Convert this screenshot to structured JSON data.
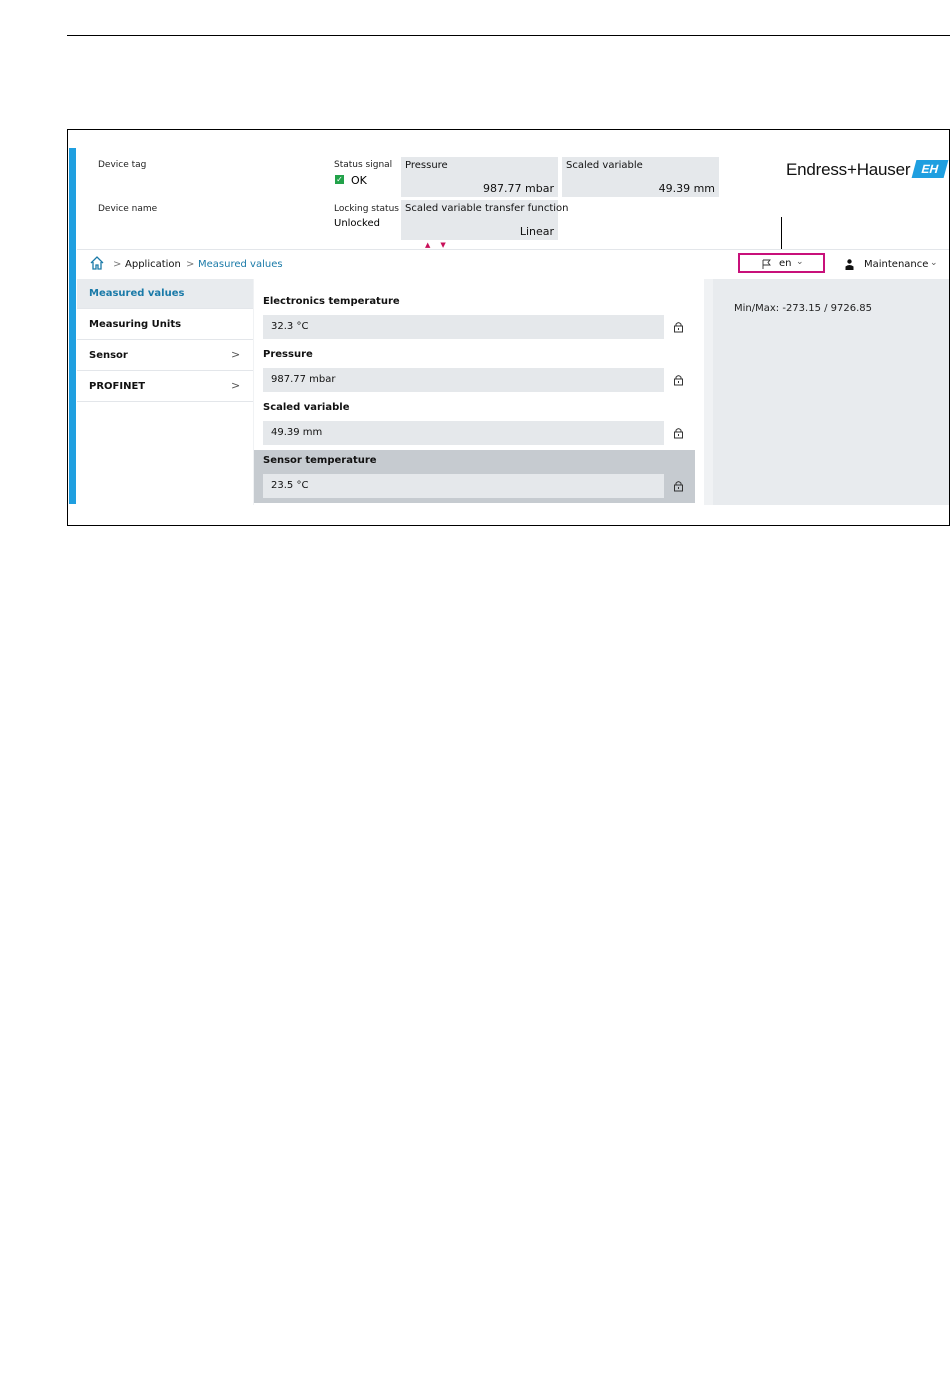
{
  "header": {
    "device_tag_label": "Device tag",
    "device_name_label": "Device name",
    "status_signal_label": "Status signal",
    "status_signal_value": "OK",
    "locking_status_label": "Locking status",
    "locking_status_value": "Unlocked",
    "tiles": [
      {
        "label": "Pressure",
        "value": "987.77 mbar"
      },
      {
        "label": "Scaled variable",
        "value": "49.39 mm"
      },
      {
        "label": "Scaled variable transfer function",
        "value": "Linear"
      }
    ],
    "logo_text": "Endress+Hauser",
    "logo_badge": "EH"
  },
  "nav": {
    "breadcrumb": [
      "Application",
      "Measured values"
    ],
    "language": "en",
    "user_role": "Maintenance"
  },
  "sidebar": {
    "items": [
      {
        "label": "Measured values",
        "active": true,
        "has_children": false
      },
      {
        "label": "Measuring Units",
        "active": false,
        "has_children": false
      },
      {
        "label": "Sensor",
        "active": false,
        "has_children": true
      },
      {
        "label": "PROFINET",
        "active": false,
        "has_children": true
      }
    ]
  },
  "main": {
    "fields": [
      {
        "label": "Electronics temperature",
        "value": "32.3 °C",
        "locked": true
      },
      {
        "label": "Pressure",
        "value": "987.77 mbar",
        "locked": true
      },
      {
        "label": "Scaled variable",
        "value": "49.39 mm",
        "locked": true
      },
      {
        "label": "Sensor temperature",
        "value": "23.5 °C",
        "locked": true,
        "selected": true
      }
    ]
  },
  "help_panel": {
    "text": "Min/Max: -273.15 / 9726.85"
  },
  "colors": {
    "accent_blue": "#1f9fe0",
    "link_blue": "#1a7aa8",
    "highlight_magenta": "#c8107a",
    "status_ok_green": "#22a24a"
  }
}
